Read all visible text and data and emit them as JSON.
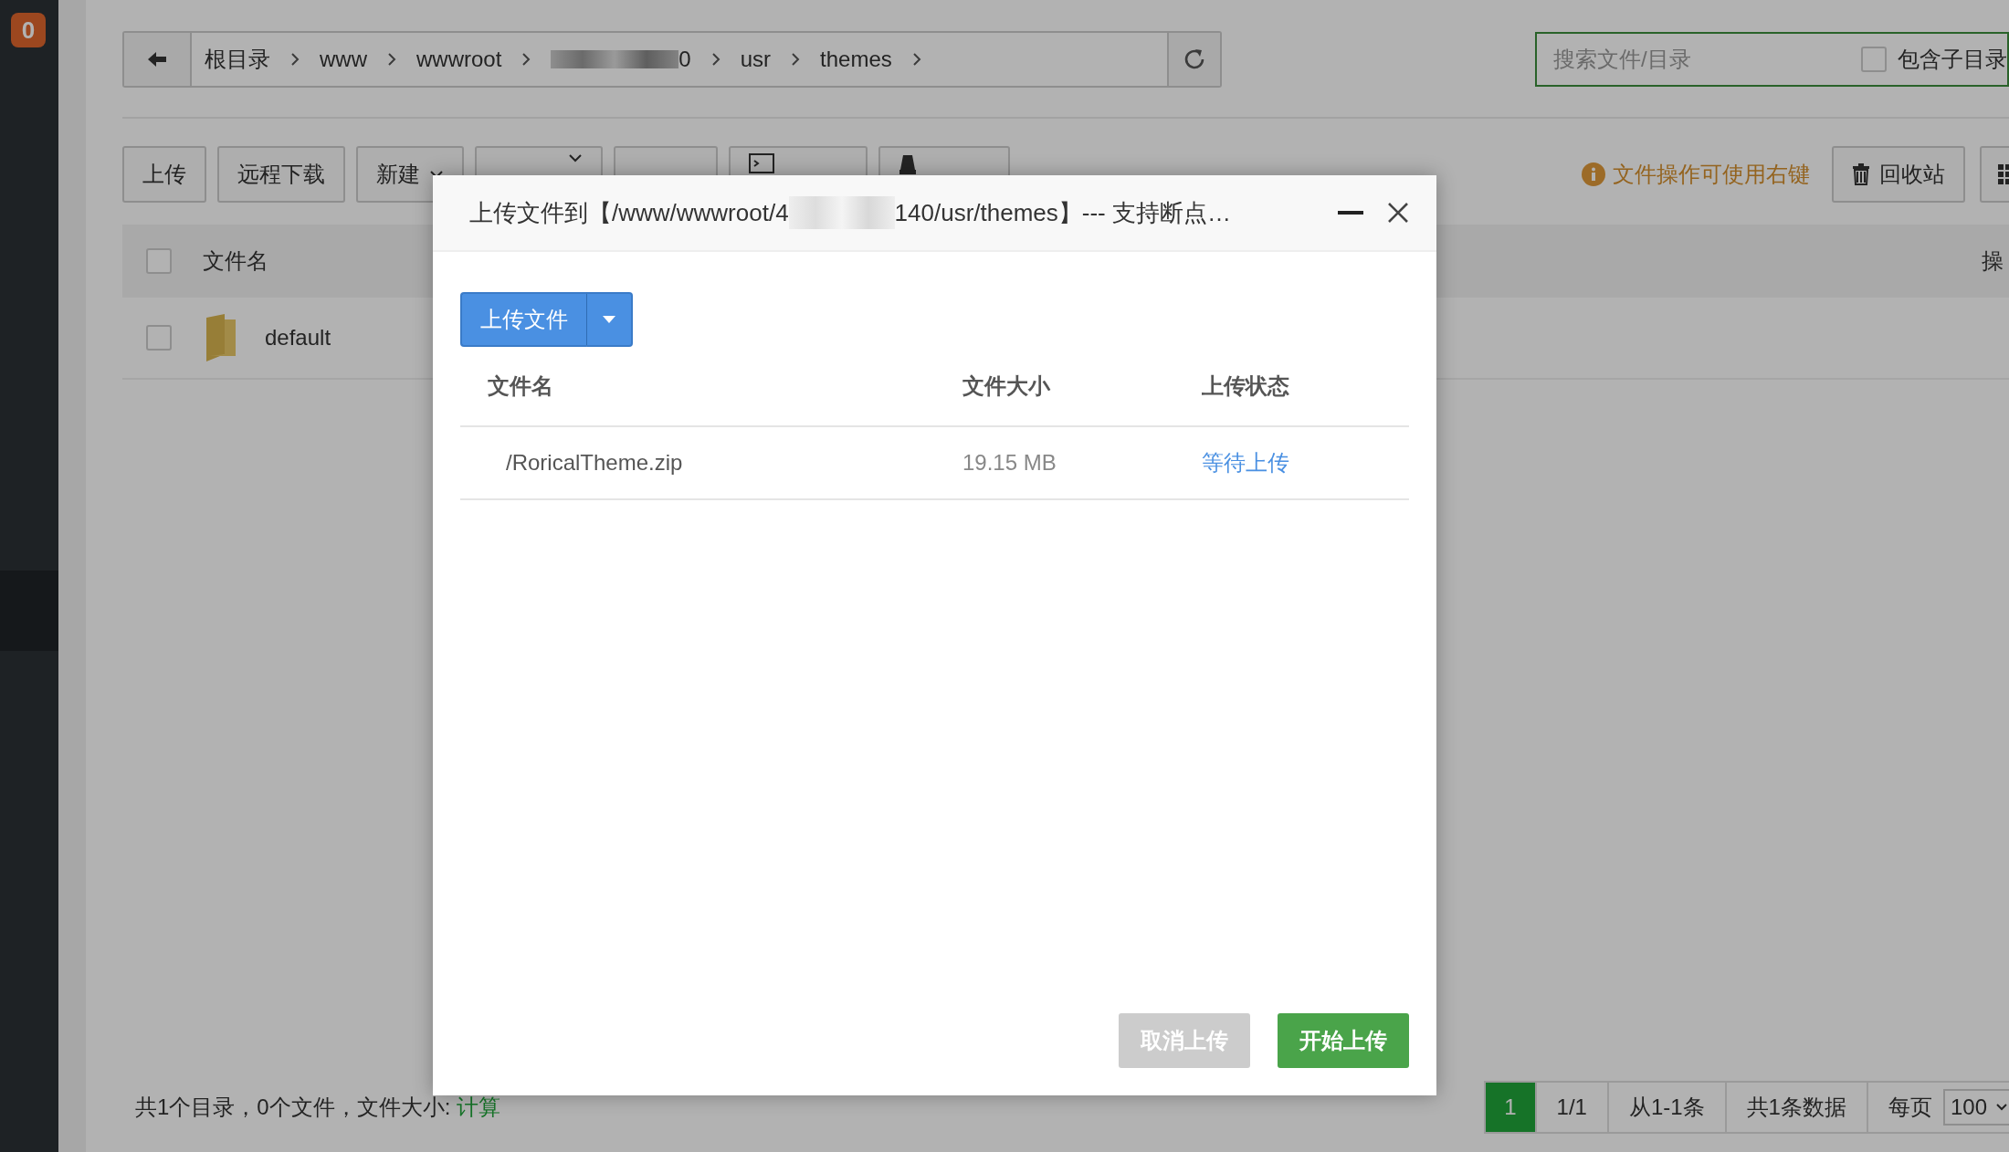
{
  "sidebar": {
    "badge": "0"
  },
  "breadcrumb": {
    "items": [
      {
        "label": "根目录",
        "redacted": false
      },
      {
        "label": "www",
        "redacted": false
      },
      {
        "label": "wwwroot",
        "redacted": false
      },
      {
        "label": "0",
        "redacted": true
      },
      {
        "label": "usr",
        "redacted": false
      },
      {
        "label": "themes",
        "redacted": false
      }
    ]
  },
  "search": {
    "placeholder": "搜索文件/目录",
    "include_subdirs": {
      "label": "包含子目录",
      "checked": false
    }
  },
  "toolbar": {
    "buttons": [
      {
        "label": "上传",
        "kind": "plain"
      },
      {
        "label": "远程下载",
        "kind": "plain"
      },
      {
        "label": "新建",
        "kind": "dropdown"
      },
      {
        "kind": "dropdown"
      },
      {
        "kind": "plain"
      },
      {
        "kind": "terminal"
      },
      {
        "kind": "disk"
      }
    ],
    "tip": "文件操作可使用右键",
    "recycle": "回收站"
  },
  "file_table": {
    "select_all": {
      "checked": false
    },
    "columns": [
      "文件名",
      "操"
    ],
    "rows": [
      {
        "name": "default",
        "checked": false
      }
    ]
  },
  "footer": {
    "summary": "共1个目录，0个文件，文件大小:",
    "calc_link": "计算"
  },
  "pagination": {
    "pages": [
      {
        "label": "1",
        "selected": true
      }
    ],
    "info": [
      "1/1",
      "从1-1条",
      "共1条数据"
    ],
    "per_page_label": "每页",
    "per_page": "100"
  },
  "dialog": {
    "title_prefix": "上传文件到【/www/wwwroot/4",
    "title_suffix": "140/usr/themes】--- 支持断点…",
    "upload_button": "上传文件",
    "columns": [
      "文件名",
      "文件大小",
      "上传状态"
    ],
    "files": [
      {
        "name": "/RoricalTheme.zip",
        "size": "19.15 MB",
        "status": "等待上传"
      }
    ],
    "cancel": "取消上传",
    "start": "开始上传"
  }
}
